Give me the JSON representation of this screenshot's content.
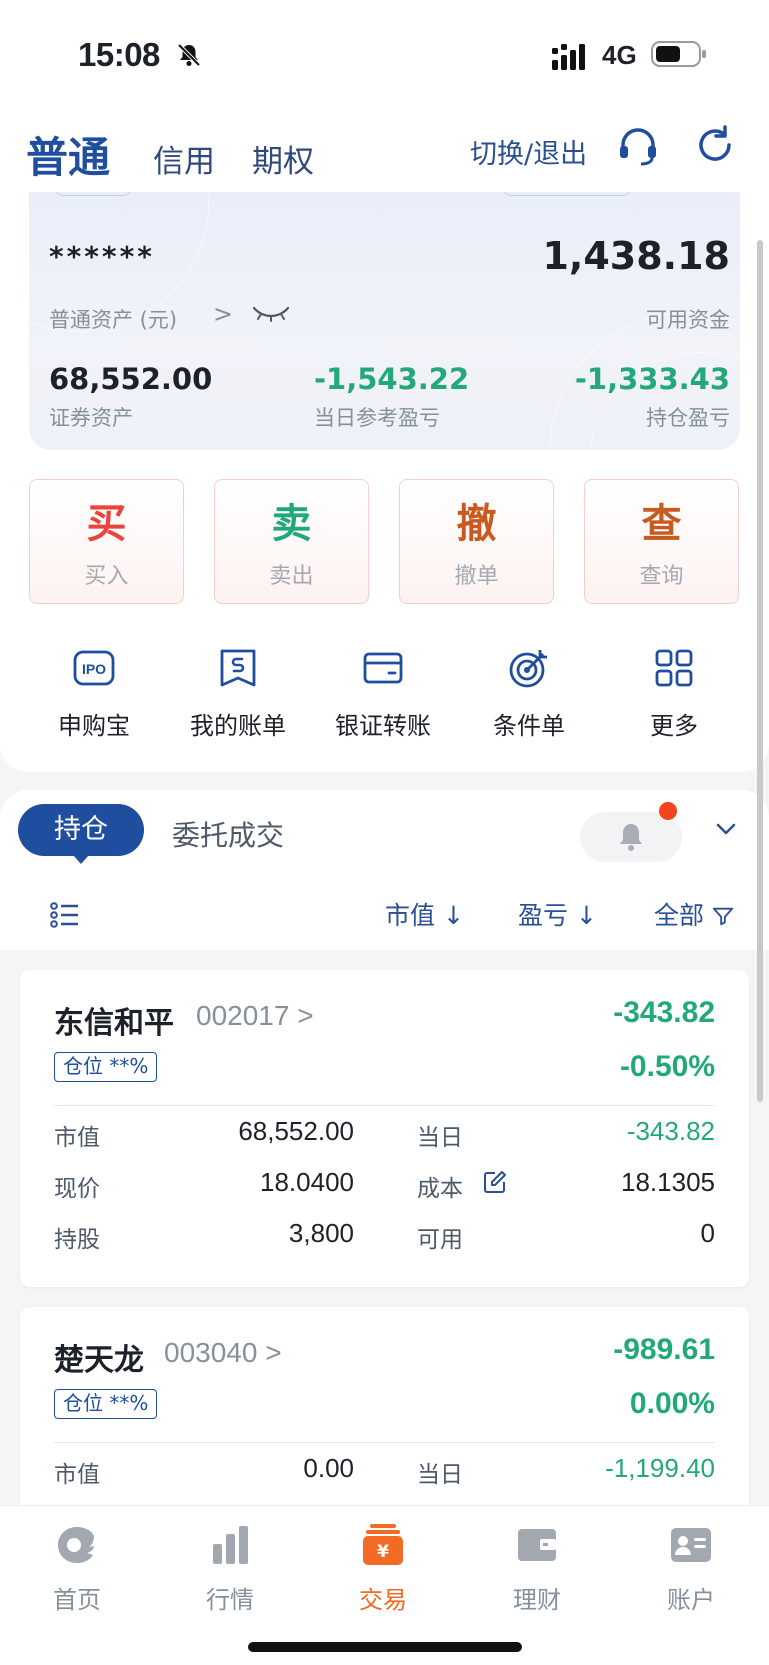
{
  "status_bar": {
    "time": "15:08",
    "network": "4G"
  },
  "header": {
    "tabs": [
      "普通",
      "信用",
      "期权"
    ],
    "switch_exit": "切换/退出"
  },
  "asset_card": {
    "masked_total": "******",
    "asset_label": "普通资产 (元)",
    "available_value": "1,438.18",
    "available_label": "可用资金",
    "securities_value": "68,552.00",
    "securities_label": "证券资产",
    "day_pnl_value": "-1,543.22",
    "day_pnl_label": "当日参考盈亏",
    "position_pnl_value": "-1,333.43",
    "position_pnl_label": "持仓盈亏"
  },
  "trade_buttons": [
    {
      "big": "买",
      "small": "买入",
      "color": "#e8453c"
    },
    {
      "big": "卖",
      "small": "卖出",
      "color": "#23a87a"
    },
    {
      "big": "撤",
      "small": "撤单",
      "color": "#c8591f"
    },
    {
      "big": "查",
      "small": "查询",
      "color": "#c8591f"
    }
  ],
  "tools": [
    {
      "label": "申购宝",
      "icon": "ipo-icon"
    },
    {
      "label": "我的账单",
      "icon": "bill-icon"
    },
    {
      "label": "银证转账",
      "icon": "card-icon"
    },
    {
      "label": "条件单",
      "icon": "target-icon"
    },
    {
      "label": "更多",
      "icon": "grid-icon"
    }
  ],
  "holdings": {
    "tab_active": "持仓",
    "tab_other": "委托成交",
    "sort_market": "市值 ↓",
    "sort_pnl": "盈亏 ↓",
    "filter": "全部"
  },
  "positions": [
    {
      "name": "东信和平",
      "code": "002017",
      "pnl": "-343.82",
      "pct": "-0.50%",
      "badge": "仓位 **%",
      "mv_label": "市值",
      "mv": "68,552.00",
      "day_label": "当日",
      "day": "-343.82",
      "price_label": "现价",
      "price": "18.0400",
      "cost_label": "成本",
      "cost": "18.1305",
      "shares_label": "持股",
      "shares": "3,800",
      "avail_label": "可用",
      "avail": "0"
    },
    {
      "name": "楚天龙",
      "code": "003040",
      "pnl": "-989.61",
      "pct": "0.00%",
      "badge": "仓位 **%",
      "mv_label": "市值",
      "mv": "0.00",
      "day_label": "当日",
      "day": "-1,199.40"
    }
  ],
  "tabbar": [
    {
      "label": "首页",
      "icon": "home-icon"
    },
    {
      "label": "行情",
      "icon": "chart-icon"
    },
    {
      "label": "交易",
      "icon": "trade-icon"
    },
    {
      "label": "理财",
      "icon": "wallet-icon"
    },
    {
      "label": "账户",
      "icon": "account-icon"
    }
  ],
  "colors": {
    "brand_blue": "#1f4e9e",
    "down_green": "#23a87a",
    "up_red": "#e8453c",
    "active_orange": "#f36a25"
  }
}
